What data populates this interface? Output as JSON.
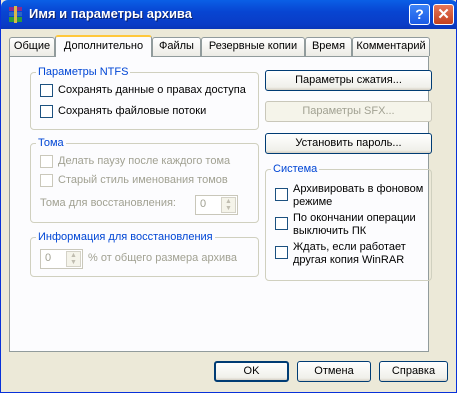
{
  "window": {
    "title": "Имя и параметры архива"
  },
  "titlebar": {
    "help_glyph": "?",
    "close_glyph": "✕"
  },
  "tabs": [
    {
      "label": "Общие"
    },
    {
      "label": "Дополнительно"
    },
    {
      "label": "Файлы"
    },
    {
      "label": "Резервные копии"
    },
    {
      "label": "Время"
    },
    {
      "label": "Комментарий"
    }
  ],
  "ntfs": {
    "legend": "Параметры NTFS",
    "items": [
      {
        "label": "Сохранять данные о правах доступа",
        "checked": false
      },
      {
        "label": "Сохранять файловые потоки",
        "checked": false
      }
    ]
  },
  "volumes": {
    "legend": "Тома",
    "items": [
      {
        "label": "Делать паузу после каждого тома",
        "checked": false
      },
      {
        "label": "Старый стиль именования томов",
        "checked": false
      }
    ],
    "recovery_volumes_label": "Тома для восстановления:",
    "recovery_volumes_value": "0"
  },
  "recovery": {
    "legend": "Информация для восстановления",
    "value": "0",
    "suffix": "% от общего размера архива"
  },
  "right_buttons": {
    "compression": "Параметры сжатия...",
    "sfx": "Параметры SFX...",
    "password": "Установить пароль..."
  },
  "system": {
    "legend": "Система",
    "items": [
      {
        "label": "Архивировать в фоновом режиме",
        "checked": false
      },
      {
        "label": "По окончании операции выключить ПК",
        "checked": false
      },
      {
        "label": "Ждать, если работает другая копия WinRAR",
        "checked": false
      }
    ]
  },
  "footer": {
    "ok": "OK",
    "cancel": "Отмена",
    "help": "Справка"
  },
  "colors": {
    "title_bar": "#0a4fd8",
    "accent_legend": "#0046d5",
    "active_tab_highlight": "#ffc83c",
    "disabled_text": "#a1a192"
  }
}
